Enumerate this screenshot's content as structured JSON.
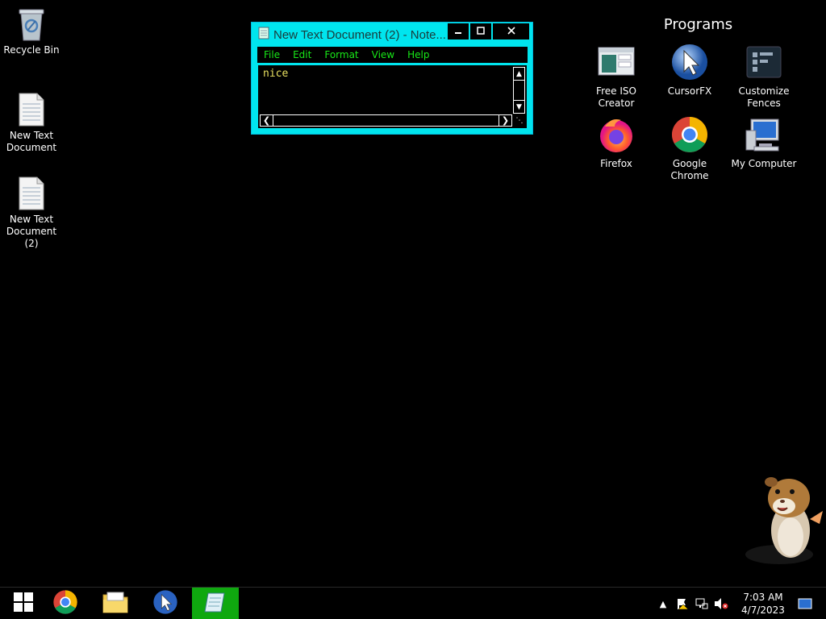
{
  "desktop_icons": [
    {
      "label": "Recycle Bin",
      "icon": "recycle-bin-icon"
    },
    {
      "label": "New Text\nDocument",
      "icon": "text-document-icon"
    },
    {
      "label": "New Text\nDocument (2)",
      "icon": "text-document-icon"
    }
  ],
  "fence": {
    "title": "Programs",
    "items": [
      {
        "label": "Free ISO\nCreator",
        "icon": "iso-creator-icon"
      },
      {
        "label": "CursorFX",
        "icon": "cursorfx-icon"
      },
      {
        "label": "Customize\nFences",
        "icon": "fences-icon"
      },
      {
        "label": "Firefox",
        "icon": "firefox-icon"
      },
      {
        "label": "Google\nChrome",
        "icon": "chrome-icon"
      },
      {
        "label": "My Computer",
        "icon": "computer-icon"
      }
    ]
  },
  "notepad": {
    "title": "New Text Document (2) - Note...",
    "menu": [
      "File",
      "Edit",
      "Format",
      "View",
      "Help"
    ],
    "content": "nice",
    "controls": {
      "minimize": "minimize-icon",
      "maximize": "maximize-icon",
      "close": "close-icon"
    }
  },
  "taskbar": {
    "buttons": [
      "start-icon",
      "chrome-icon",
      "file-explorer-icon",
      "cursorfx-icon",
      "notepad-icon"
    ],
    "active_index": 4,
    "tray": [
      "show-hidden-icons-icon",
      "action-center-warning-icon",
      "network-icon",
      "volume-muted-icon"
    ],
    "time": "7:03 AM",
    "date": "4/7/2023"
  },
  "colors": {
    "window_frame": "#00e5ee",
    "menu_text": "#18e818",
    "editor_text": "#e8e060",
    "active_taskbar": "#0fa80f",
    "desktop": "#000000"
  }
}
